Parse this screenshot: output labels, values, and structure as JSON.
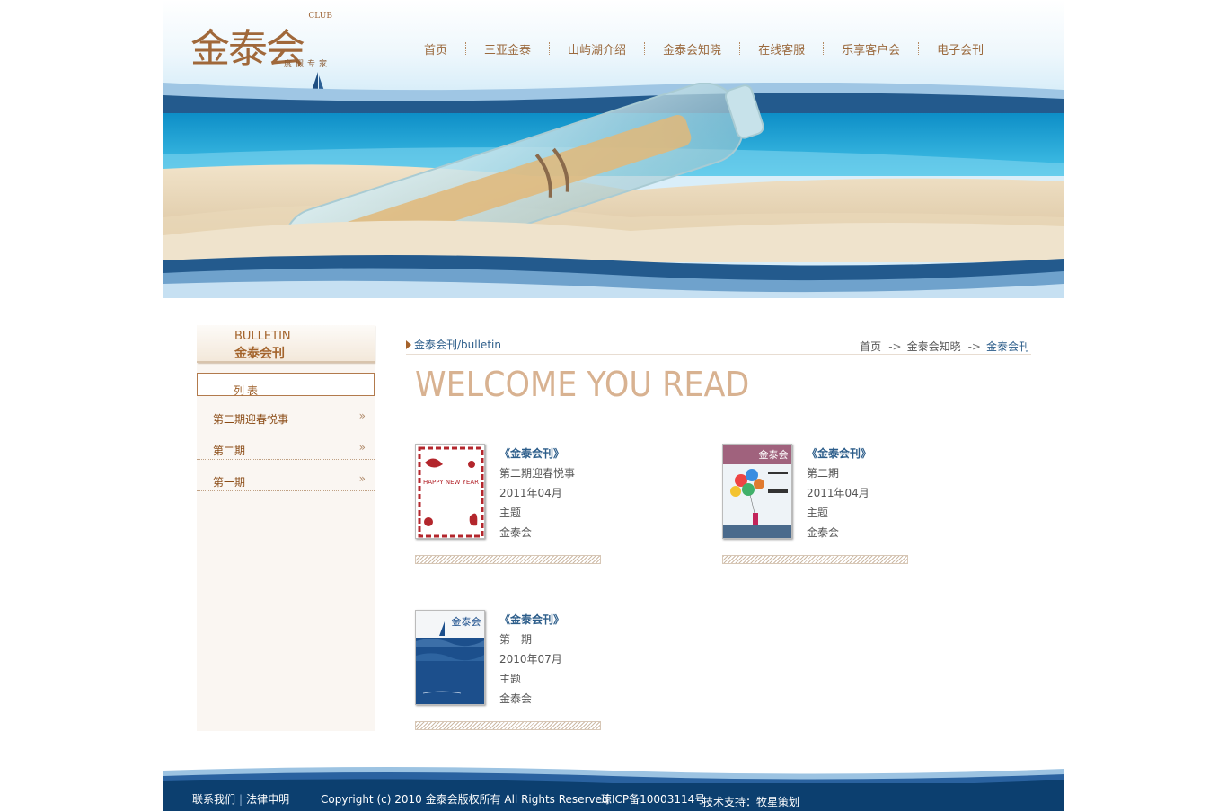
{
  "header": {
    "logo": {
      "main": "金泰会",
      "club": "CLUB",
      "sub": "度假专家"
    },
    "nav": [
      "首页",
      "三亚金泰",
      "山屿湖介绍",
      "金泰会知晓",
      "在线客服",
      "乐享客户会",
      "电子会刊"
    ]
  },
  "sidebar": {
    "title_en": "BULLETIN",
    "title_cn": "金泰会刊",
    "list_head": "列表",
    "items": [
      "第二期迎春悦事",
      "第二期",
      "第一期"
    ],
    "arrow": "»"
  },
  "main": {
    "crumb_left": "金泰会刊/bulletin",
    "crumb_right": {
      "home": "首页",
      "arrow": "->",
      "middle": "金泰会知晓",
      "current": "金泰会刊"
    },
    "welcome": "WELCOME YOU READ",
    "magazines": [
      {
        "title": "《金泰会刊》",
        "issue": "第二期迎春悦事",
        "date": "2011年04月",
        "theme": "主题",
        "org": "金泰会",
        "cover_text": "HAPPY NEW YEAR"
      },
      {
        "title": "《金泰会刊》",
        "issue": "第二期",
        "date": "2011年04月",
        "theme": "主题",
        "org": "金泰会",
        "cover_text": "金泰会"
      },
      {
        "title": "《金泰会刊》",
        "issue": "第一期",
        "date": "2010年07月",
        "theme": "主题",
        "org": "金泰会",
        "cover_text": "金泰会"
      }
    ]
  },
  "footer": {
    "contact": "联系我们",
    "sep": "|",
    "legal": "法律申明",
    "copyright": "Copyright (c) 2010 金泰会版权所有 All Rights Reserved.",
    "icp": "琼ICP备10003114号",
    "tech": "技术支持：牧星策划"
  }
}
